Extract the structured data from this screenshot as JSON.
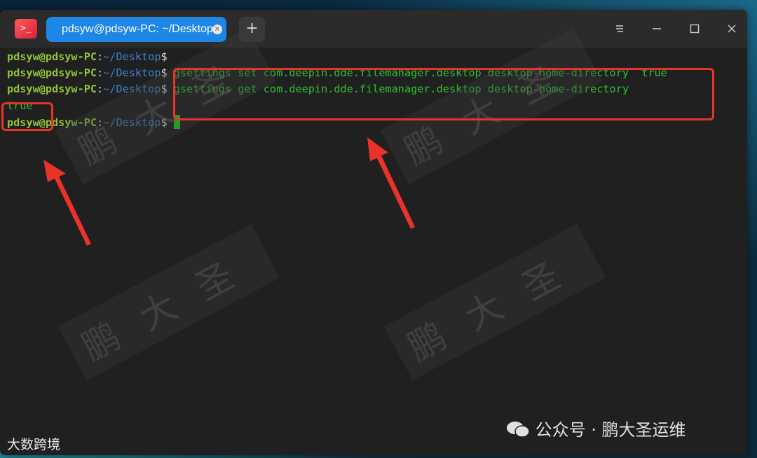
{
  "app": {
    "icon_text": ">_",
    "tab_title": "pdsyw@pdsyw-PC: ~/Desktop",
    "tab_close_symbol": "×",
    "add_tab_symbol": "+"
  },
  "window_controls": {
    "menu_icon": "menu-icon",
    "minimize_icon": "minimize-icon",
    "maximize_icon": "maximize-icon",
    "close_icon": "close-icon"
  },
  "terminal": {
    "prompt_user": "pdsyw@pdsyw-PC",
    "prompt_sep": ":",
    "prompt_path": "~/Desktop",
    "prompt_dollar": "$",
    "lines": [
      {
        "type": "prompt",
        "command": ""
      },
      {
        "type": "prompt",
        "command": " gsettings set com.deepin.dde.filemanager.desktop desktop-home-directory  true"
      },
      {
        "type": "prompt",
        "command": " gsettings get com.deepin.dde.filemanager.desktop desktop-home-directory"
      },
      {
        "type": "output",
        "text": "true"
      },
      {
        "type": "prompt",
        "command": " "
      }
    ]
  },
  "watermark_text": "鹏大圣",
  "bottom_left_brand": "大数跨境",
  "bottom_right_brand": "公众号 · 鹏大圣运维",
  "colors": {
    "annotation_red": "#e8322a",
    "tab_blue": "#1e86e6",
    "prompt_green": "#8fc23a",
    "path_blue": "#3f7fcf",
    "command_green": "#2fbf2f"
  }
}
